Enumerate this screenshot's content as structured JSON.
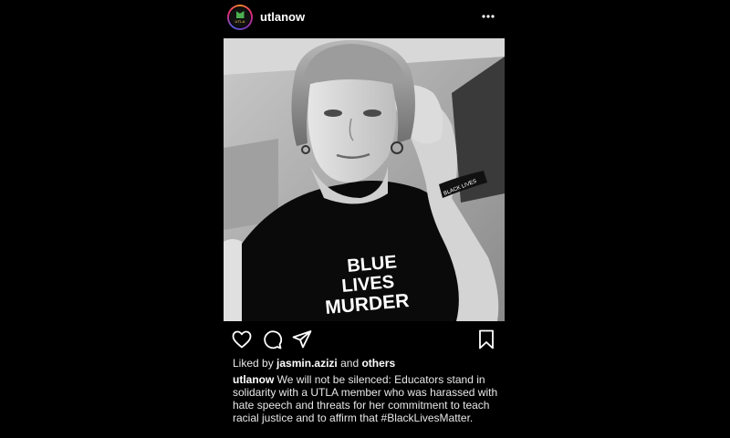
{
  "post": {
    "username": "utlanow",
    "avatar_text": "UTLA",
    "shirt_text": [
      "BLUE",
      "LIVES",
      "MURDER"
    ],
    "wristband_text": "BLACK LIVES",
    "liked_prefix": "Liked by",
    "liked_user": "jasmin.azizi",
    "liked_connector": "and",
    "liked_others": "others",
    "caption_user": "utlanow",
    "caption_text": "We will not be silenced: Educators stand in solidarity with a UTLA member who was harassed with hate speech and threats for her commitment to teach racial justice and to affirm that #BlackLivesMatter."
  },
  "icons": {
    "more": "more-options-icon",
    "like": "heart-icon",
    "comment": "comment-icon",
    "share": "send-icon",
    "save": "bookmark-icon"
  },
  "colors": {
    "background": "#000000",
    "text": "#ffffff",
    "muted_text": "#e8e8e8"
  }
}
